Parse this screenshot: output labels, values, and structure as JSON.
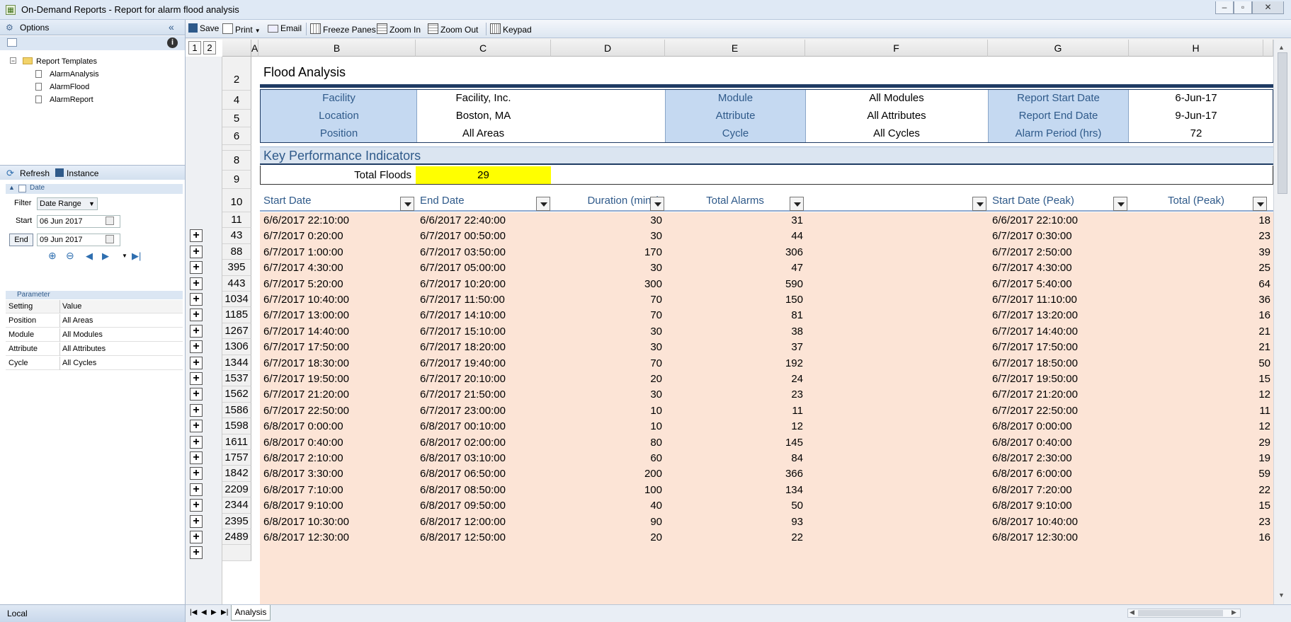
{
  "window": {
    "title": "On-Demand Reports - Report for alarm flood analysis"
  },
  "left": {
    "options_label": "Options",
    "tree": {
      "root": "Report Templates",
      "items": [
        "AlarmAnalysis",
        "AlarmFlood",
        "AlarmReport"
      ]
    },
    "actions": {
      "refresh": "Refresh",
      "instance": "Instance"
    },
    "date_group": "Date",
    "filter_label": "Filter",
    "filter_value": "Date Range",
    "start_label": "Start",
    "start_value": "06 Jun  2017",
    "end_label": "End",
    "end_value": "09 Jun  2017",
    "param_group": "Parameter",
    "param_headers": {
      "setting": "Setting",
      "value": "Value"
    },
    "params": [
      {
        "setting": "Position",
        "value": "All Areas"
      },
      {
        "setting": "Module",
        "value": "All Modules"
      },
      {
        "setting": "Attribute",
        "value": "All Attributes"
      },
      {
        "setting": "Cycle",
        "value": "All Cycles"
      }
    ],
    "footer": "Local"
  },
  "toolbar": {
    "save": "Save",
    "print": "Print",
    "email": "Email",
    "freeze": "Freeze Panes",
    "zoom_in": "Zoom In",
    "zoom_out": "Zoom Out",
    "keypad": "Keypad"
  },
  "sheet": {
    "outline_levels": [
      "1",
      "2"
    ],
    "columns": [
      "A",
      "B",
      "C",
      "D",
      "E",
      "F",
      "G",
      "H"
    ],
    "title": "Flood Analysis",
    "info": {
      "facility_label": "Facility",
      "facility": "Facility, Inc.",
      "location_label": "Location",
      "location": "Boston, MA",
      "position_label": "Position",
      "position": "All Areas",
      "module_label": "Module",
      "module": "All Modules",
      "attribute_label": "Attribute",
      "attribute": "All Attributes",
      "cycle_label": "Cycle",
      "cycle": "All Cycles",
      "start_label": "Report Start Date",
      "start": "6-Jun-17",
      "end_label": "Report End Date",
      "end": "9-Jun-17",
      "period_label": "Alarm Period (hrs)",
      "period": "72"
    },
    "kpi_title": "Key Performance Indicators",
    "total_floods_label": "Total Floods",
    "total_floods": "29",
    "table_headers": {
      "start": "Start Date",
      "end": "End Date",
      "duration": "Duration (mins)",
      "alarms": "Total Alarms",
      "start_peak": "Start Date (Peak)",
      "total_peak": "Total (Peak)"
    },
    "rows": [
      {
        "row": "11",
        "start": "6/6/2017 22:10:00",
        "end": "6/6/2017 22:40:00",
        "duration": "30",
        "alarms": "31",
        "start_peak": "6/6/2017 22:10:00",
        "total_peak": "18"
      },
      {
        "row": "43",
        "start": "6/7/2017 0:20:00",
        "end": "6/7/2017 00:50:00",
        "duration": "30",
        "alarms": "44",
        "start_peak": "6/7/2017 0:30:00",
        "total_peak": "23"
      },
      {
        "row": "88",
        "start": "6/7/2017 1:00:00",
        "end": "6/7/2017 03:50:00",
        "duration": "170",
        "alarms": "306",
        "start_peak": "6/7/2017 2:50:00",
        "total_peak": "39"
      },
      {
        "row": "395",
        "start": "6/7/2017 4:30:00",
        "end": "6/7/2017 05:00:00",
        "duration": "30",
        "alarms": "47",
        "start_peak": "6/7/2017 4:30:00",
        "total_peak": "25"
      },
      {
        "row": "443",
        "start": "6/7/2017 5:20:00",
        "end": "6/7/2017 10:20:00",
        "duration": "300",
        "alarms": "590",
        "start_peak": "6/7/2017 5:40:00",
        "total_peak": "64"
      },
      {
        "row": "1034",
        "start": "6/7/2017 10:40:00",
        "end": "6/7/2017 11:50:00",
        "duration": "70",
        "alarms": "150",
        "start_peak": "6/7/2017 11:10:00",
        "total_peak": "36"
      },
      {
        "row": "1185",
        "start": "6/7/2017 13:00:00",
        "end": "6/7/2017 14:10:00",
        "duration": "70",
        "alarms": "81",
        "start_peak": "6/7/2017 13:20:00",
        "total_peak": "16"
      },
      {
        "row": "1267",
        "start": "6/7/2017 14:40:00",
        "end": "6/7/2017 15:10:00",
        "duration": "30",
        "alarms": "38",
        "start_peak": "6/7/2017 14:40:00",
        "total_peak": "21"
      },
      {
        "row": "1306",
        "start": "6/7/2017 17:50:00",
        "end": "6/7/2017 18:20:00",
        "duration": "30",
        "alarms": "37",
        "start_peak": "6/7/2017 17:50:00",
        "total_peak": "21"
      },
      {
        "row": "1344",
        "start": "6/7/2017 18:30:00",
        "end": "6/7/2017 19:40:00",
        "duration": "70",
        "alarms": "192",
        "start_peak": "6/7/2017 18:50:00",
        "total_peak": "50"
      },
      {
        "row": "1537",
        "start": "6/7/2017 19:50:00",
        "end": "6/7/2017 20:10:00",
        "duration": "20",
        "alarms": "24",
        "start_peak": "6/7/2017 19:50:00",
        "total_peak": "15"
      },
      {
        "row": "1562",
        "start": "6/7/2017 21:20:00",
        "end": "6/7/2017 21:50:00",
        "duration": "30",
        "alarms": "23",
        "start_peak": "6/7/2017 21:20:00",
        "total_peak": "12"
      },
      {
        "row": "1586",
        "start": "6/7/2017 22:50:00",
        "end": "6/7/2017 23:00:00",
        "duration": "10",
        "alarms": "11",
        "start_peak": "6/7/2017 22:50:00",
        "total_peak": "11"
      },
      {
        "row": "1598",
        "start": "6/8/2017 0:00:00",
        "end": "6/8/2017 00:10:00",
        "duration": "10",
        "alarms": "12",
        "start_peak": "6/8/2017 0:00:00",
        "total_peak": "12"
      },
      {
        "row": "1611",
        "start": "6/8/2017 0:40:00",
        "end": "6/8/2017 02:00:00",
        "duration": "80",
        "alarms": "145",
        "start_peak": "6/8/2017 0:40:00",
        "total_peak": "29"
      },
      {
        "row": "1757",
        "start": "6/8/2017 2:10:00",
        "end": "6/8/2017 03:10:00",
        "duration": "60",
        "alarms": "84",
        "start_peak": "6/8/2017 2:30:00",
        "total_peak": "19"
      },
      {
        "row": "1842",
        "start": "6/8/2017 3:30:00",
        "end": "6/8/2017 06:50:00",
        "duration": "200",
        "alarms": "366",
        "start_peak": "6/8/2017 6:00:00",
        "total_peak": "59"
      },
      {
        "row": "2209",
        "start": "6/8/2017 7:10:00",
        "end": "6/8/2017 08:50:00",
        "duration": "100",
        "alarms": "134",
        "start_peak": "6/8/2017 7:20:00",
        "total_peak": "22"
      },
      {
        "row": "2344",
        "start": "6/8/2017 9:10:00",
        "end": "6/8/2017 09:50:00",
        "duration": "40",
        "alarms": "50",
        "start_peak": "6/8/2017 9:10:00",
        "total_peak": "15"
      },
      {
        "row": "2395",
        "start": "6/8/2017 10:30:00",
        "end": "6/8/2017 12:00:00",
        "duration": "90",
        "alarms": "93",
        "start_peak": "6/8/2017 10:40:00",
        "total_peak": "23"
      },
      {
        "row": "2489",
        "start": "6/8/2017 12:30:00",
        "end": "6/8/2017 12:50:00",
        "duration": "20",
        "alarms": "22",
        "start_peak": "6/8/2017 12:30:00",
        "total_peak": "16"
      }
    ],
    "sheet_tab": "Analysis"
  },
  "colors": {
    "label_fill": "#c5d9f1",
    "header_fill": "#dbe5f1",
    "data_fill": "#fce4d6",
    "kpi_fill": "#ffff00",
    "accent": "#2f5a8a"
  }
}
